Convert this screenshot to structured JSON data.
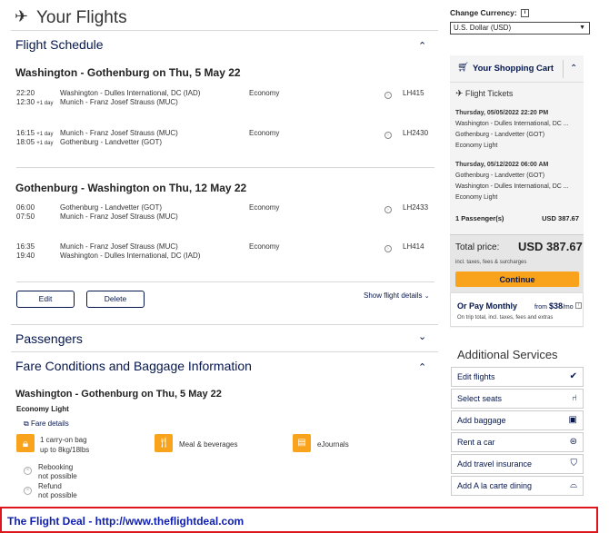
{
  "page": {
    "title": "Your Flights"
  },
  "schedule": {
    "title": "Flight Schedule",
    "outbound": {
      "title": "Washington - Gothenburg on Thu, 5 May 22",
      "legs": [
        {
          "dep_time": "22:20",
          "dep_day": "",
          "arr_time": "12:30",
          "arr_day": "+1 day",
          "from": "Washington - Dulles International, DC (IAD)",
          "to": "Munich - Franz Josef Strauss (MUC)",
          "cabin": "Economy",
          "flight": "LH415"
        },
        {
          "dep_time": "16:15",
          "dep_day": "+1 day",
          "arr_time": "18:05",
          "arr_day": "+1 day",
          "from": "Munich - Franz Josef Strauss (MUC)",
          "to": "Gothenburg - Landvetter (GOT)",
          "cabin": "Economy",
          "flight": "LH2430"
        }
      ]
    },
    "inbound": {
      "title": "Gothenburg - Washington on Thu, 12 May 22",
      "legs": [
        {
          "dep_time": "06:00",
          "dep_day": "",
          "arr_time": "07:50",
          "arr_day": "",
          "from": "Gothenburg - Landvetter (GOT)",
          "to": "Munich - Franz Josef Strauss (MUC)",
          "cabin": "Economy",
          "flight": "LH2433"
        },
        {
          "dep_time": "16:35",
          "dep_day": "",
          "arr_time": "19:40",
          "arr_day": "",
          "from": "Munich - Franz Josef Strauss (MUC)",
          "to": "Washington - Dulles International, DC (IAD)",
          "cabin": "Economy",
          "flight": "LH414"
        }
      ]
    },
    "edit_label": "Edit",
    "delete_label": "Delete",
    "show_details_label": "Show flight details"
  },
  "passengers": {
    "title": "Passengers"
  },
  "fare": {
    "title": "Fare Conditions and Baggage Information",
    "route_title": "Washington - Gothenburg on Thu, 5 May 22",
    "fare_name": "Economy Light",
    "fare_details_label": "Fare details",
    "bag_line1": "1 carry-on bag",
    "bag_line2": "up to 8kg/18lbs",
    "meal_label": "Meal & beverages",
    "ejournals_label": "eJournals",
    "rebooking_line1": "Rebooking",
    "rebooking_line2": "not possible",
    "refund_line1": "Refund",
    "refund_line2": "not possible"
  },
  "currency": {
    "label": "Change Currency:",
    "info_glyph": "i",
    "selected": "U.S. Dollar (USD)"
  },
  "cart": {
    "title": "Your Shopping Cart",
    "section_title": "Flight Tickets",
    "trips": [
      {
        "date": "Thursday, 05/05/2022 22:20 PM",
        "from": "Washington - Dulles International, DC ...",
        "to": "Gothenburg - Landvetter (GOT)",
        "fare": "Economy Light"
      },
      {
        "date": "Thursday, 05/12/2022 06:00 AM",
        "from": "Gothenburg - Landvetter (GOT)",
        "to": "Washington - Dulles International, DC ...",
        "fare": "Economy Light"
      }
    ],
    "passengers_label": "1 Passenger(s)",
    "passengers_price": "USD 387.67",
    "total_label": "Total price:",
    "total_value": "USD 387.67",
    "taxes_note": "incl. taxes, fees & surcharges",
    "continue_label": "Continue",
    "monthly_label": "Or Pay Monthly",
    "monthly_from": "from",
    "monthly_amount": "$38",
    "monthly_unit": "/mo",
    "monthly_note": "On trip total, incl. taxes, fees and extras"
  },
  "services": {
    "title": "Additional Services",
    "items": [
      {
        "label": "Edit flights",
        "icon": "check-icon"
      },
      {
        "label": "Select seats",
        "icon": "seat-icon"
      },
      {
        "label": "Add baggage",
        "icon": "baggage-icon"
      },
      {
        "label": "Rent a car",
        "icon": "car-icon"
      },
      {
        "label": "Add travel insurance",
        "icon": "shield-icon"
      },
      {
        "label": "Add A la carte dining",
        "icon": "dining-icon"
      }
    ]
  },
  "footer": {
    "text": "The Flight Deal - http://www.theflightdeal.com"
  },
  "colors": {
    "navy": "#05164d",
    "orange": "#f9a21b",
    "footer_border": "#e0161e",
    "footer_text": "#1020b0"
  }
}
